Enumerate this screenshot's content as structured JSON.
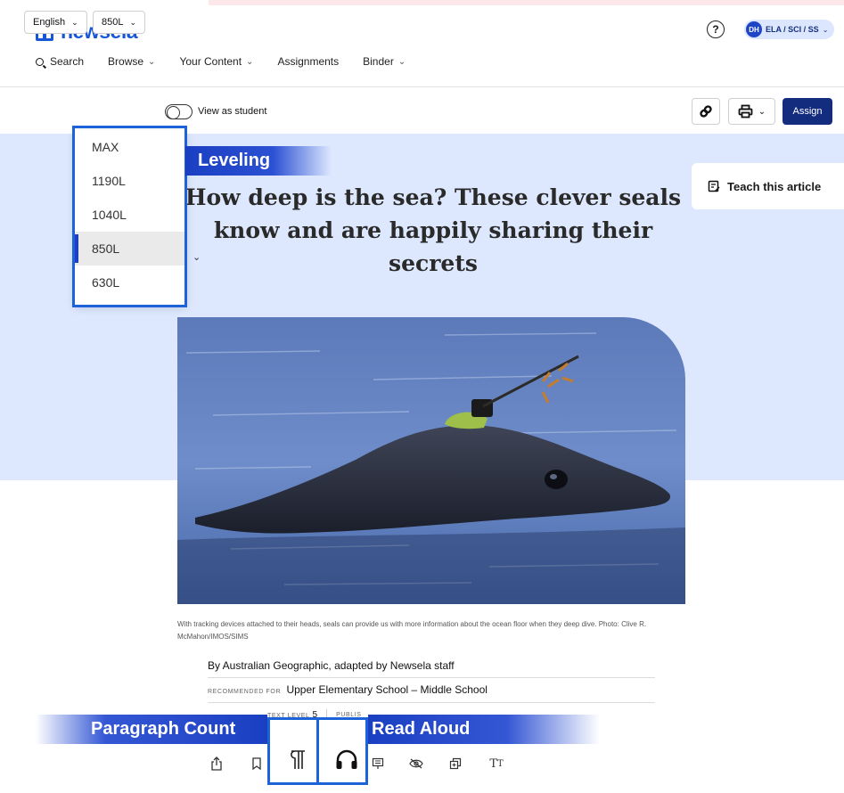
{
  "brand": {
    "name": "newsela",
    "color": "#1757d6"
  },
  "header": {
    "help_glyph": "?",
    "user": {
      "initials": "DH",
      "label": "ELA / SCI / SS",
      "chevron": "⌄"
    }
  },
  "nav": {
    "search": "Search",
    "browse": "Browse",
    "your_content": "Your Content",
    "assignments": "Assignments",
    "binder": "Binder",
    "chevron": "⌄"
  },
  "toolbar": {
    "language": "English",
    "level": "850L",
    "chevron": "⌄",
    "view_as_student": "View as student",
    "assign": "Assign"
  },
  "article": {
    "title": "How deep is the sea? These clever seals know and are happily sharing their secrets",
    "teach_label": "Teach this article",
    "caption": "With tracking devices attached to their heads, seals can provide us with more information about the ocean floor when they deep dive. Photo: Clive R. McMahon/IMOS/SIMS",
    "byline": "By Australian Geographic, adapted by Newsela staff",
    "recommended_prefix": "RECOMMENDED FOR",
    "recommended_value": "Upper Elementary School – Middle School",
    "text_level_label": "TEXT LEVEL",
    "text_level_value": "5",
    "published_label": "PUBLIS"
  },
  "level_dropdown": {
    "options": [
      "MAX",
      "1190L",
      "1040L",
      "850L",
      "630L"
    ],
    "selected": "850L"
  },
  "callouts": {
    "leveling": "Leveling",
    "paragraph_count": "Paragraph Count",
    "read_aloud": "Read Aloud"
  },
  "colors": {
    "hero_bg": "#dde8ff",
    "assign_bg": "#132c7e",
    "highlight": "#1c63d9",
    "callout_gradient_start": "#1a3fc2"
  }
}
